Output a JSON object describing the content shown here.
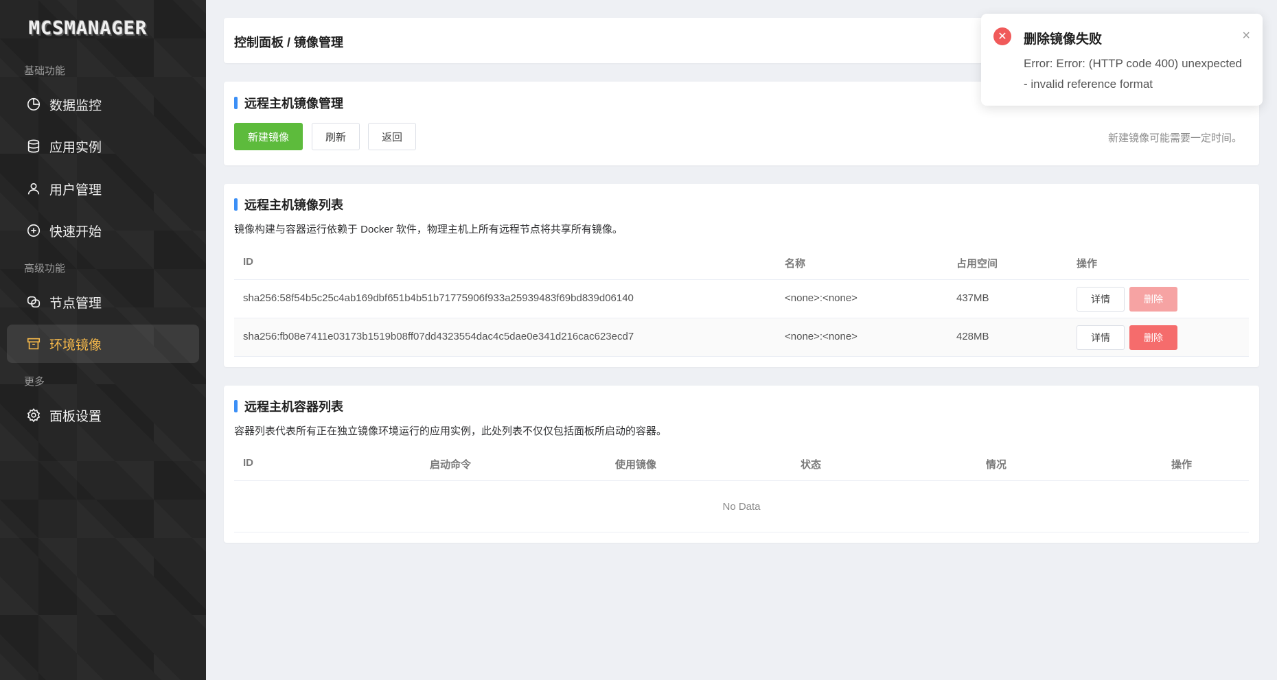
{
  "sidebar": {
    "logo": "MCSMANAGER",
    "sections": {
      "basic": "基础功能",
      "advanced": "高级功能",
      "more": "更多"
    },
    "items": [
      {
        "label": "数据监控",
        "icon": "pie-chart-icon"
      },
      {
        "label": "应用实例",
        "icon": "database-icon"
      },
      {
        "label": "用户管理",
        "icon": "user-icon"
      },
      {
        "label": "快速开始",
        "icon": "plus-circle-icon"
      },
      {
        "label": "节点管理",
        "icon": "nodes-icon"
      },
      {
        "label": "环境镜像",
        "icon": "box-icon",
        "active": true
      },
      {
        "label": "面板设置",
        "icon": "gear-icon"
      }
    ]
  },
  "breadcrumb": "控制面板 / 镜像管理",
  "image_manage": {
    "title": "远程主机镜像管理",
    "new_label": "新建镜像",
    "refresh_label": "刷新",
    "back_label": "返回",
    "hint": "新建镜像可能需要一定时间。"
  },
  "image_list": {
    "title": "远程主机镜像列表",
    "desc": "镜像构建与容器运行依赖于 Docker 软件，物理主机上所有远程节点将共享所有镜像。",
    "columns": [
      "ID",
      "名称",
      "占用空间",
      "操作"
    ],
    "rows": [
      {
        "id": "sha256:58f54b5c25c4ab169dbf651b4b51b71775906f933a25939483f69bd839d06140",
        "name": "<none>:<none>",
        "size": "437MB",
        "detail": "详情",
        "delete": "删除"
      },
      {
        "id": "sha256:fb08e7411e03173b1519b08ff07dd4323554dac4c5dae0e341d216cac623ecd7",
        "name": "<none>:<none>",
        "size": "428MB",
        "detail": "详情",
        "delete": "删除"
      }
    ]
  },
  "container_list": {
    "title": "远程主机容器列表",
    "desc": "容器列表代表所有正在独立镜像环境运行的应用实例，此处列表不仅仅包括面板所启动的容器。",
    "columns": [
      "ID",
      "启动命令",
      "使用镜像",
      "状态",
      "情况",
      "操作"
    ],
    "empty": "No Data"
  },
  "notification": {
    "title": "删除镜像失败",
    "message": "Error: Error: (HTTP code 400) unexpected - invalid reference format",
    "close": "×",
    "icon": "error-icon"
  },
  "colors": {
    "accent": "#3b8ff6",
    "primary_green": "#5dbb3c",
    "danger": "#f56c6c",
    "active_nav": "#f5b84a"
  }
}
